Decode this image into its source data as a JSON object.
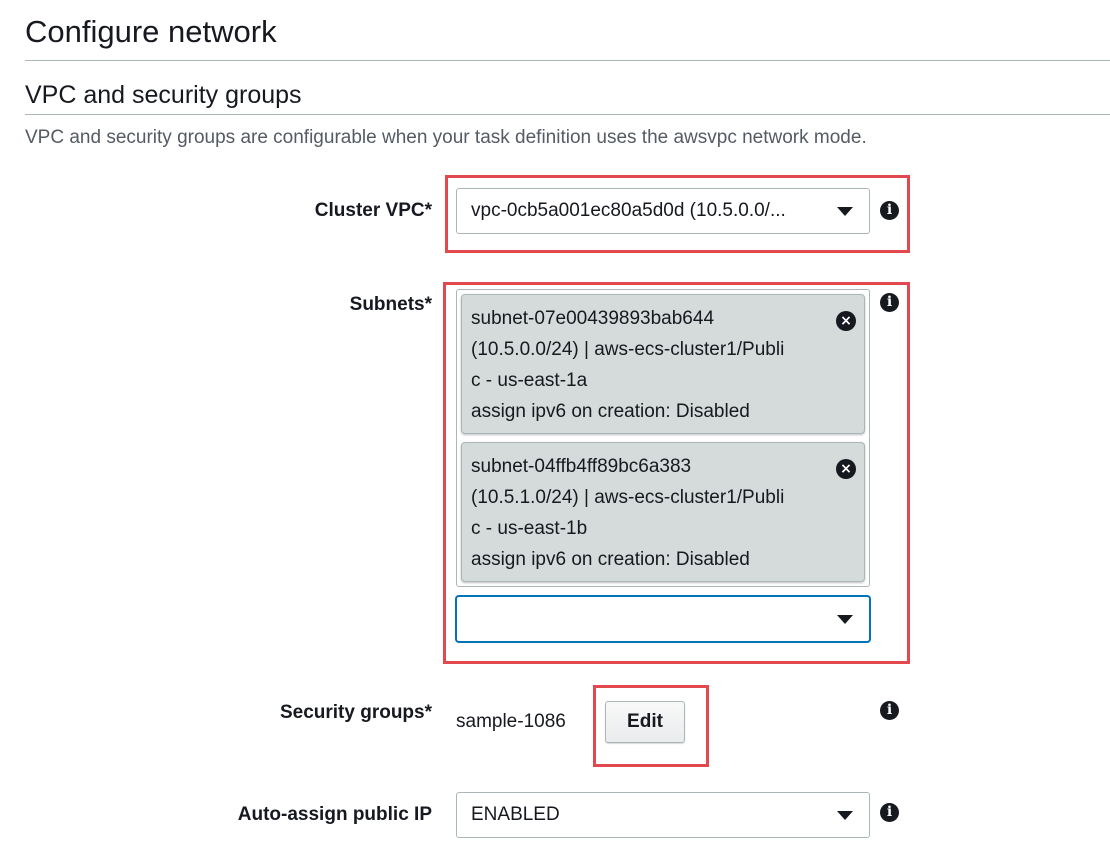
{
  "page": {
    "title": "Configure network"
  },
  "vpc_section": {
    "title": "VPC and security groups",
    "description": "VPC and security groups are configurable when your task definition uses the awsvpc network mode."
  },
  "fields": {
    "cluster_vpc": {
      "label": "Cluster VPC*",
      "value": "vpc-0cb5a001ec80a5d0d (10.5.0.0/..."
    },
    "subnets": {
      "label": "Subnets*",
      "tokens": [
        {
          "lines": [
            "subnet-07e00439893bab644",
            "(10.5.0.0/24) | aws-ecs-cluster1/Publi",
            "c - us-east-1a",
            "assign ipv6 on creation: Disabled"
          ]
        },
        {
          "lines": [
            "subnet-04ffb4ff89bc6a383",
            "(10.5.1.0/24) | aws-ecs-cluster1/Publi",
            "c - us-east-1b",
            "assign ipv6 on creation: Disabled"
          ]
        }
      ],
      "select_value": ""
    },
    "security_groups": {
      "label": "Security groups*",
      "value": "sample-1086",
      "edit_label": "Edit"
    },
    "auto_assign_ip": {
      "label": "Auto-assign public IP",
      "value": "ENABLED"
    }
  },
  "icons": {
    "info": "info-icon",
    "remove": "remove-token-icon",
    "dropdown": "caret-down-icon"
  },
  "colors": {
    "highlight": "#e2494f",
    "focus": "#0073bb",
    "token_bg": "#d5dbdb"
  }
}
